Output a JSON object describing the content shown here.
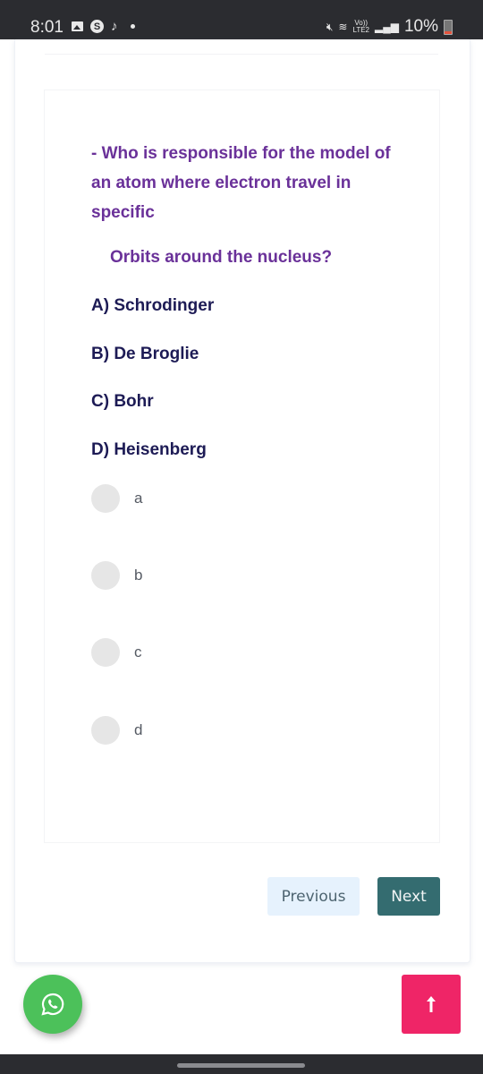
{
  "status_bar": {
    "time": "8:01",
    "left_icons": [
      "gallery-icon",
      "s-app-icon",
      "music-note-icon",
      "dot-icon"
    ],
    "right_icons": [
      "mute-icon",
      "wifi-icon",
      "volte-icon",
      "signal-icon"
    ],
    "volte_label_top": "Vo))",
    "volte_label_bottom": "LTE2",
    "battery": "10%"
  },
  "question": {
    "text": "- Who is responsible for the model of an atom where electron travel in specific",
    "continuation": "Orbits around the nucleus?",
    "options": [
      {
        "label": "A) Schrodinger"
      },
      {
        "label": "B) De Broglie"
      },
      {
        "label": "C) Bohr"
      },
      {
        "label": "D) Heisenberg"
      }
    ]
  },
  "answers": [
    {
      "label": "a",
      "selected": false
    },
    {
      "label": "b",
      "selected": false
    },
    {
      "label": "c",
      "selected": false
    },
    {
      "label": "d",
      "selected": false
    }
  ],
  "navigation": {
    "previous_label": "Previous",
    "next_label": "Next"
  },
  "floating": {
    "whatsapp_icon": "whatsapp-icon",
    "scroll_top_icon": "arrow-up-icon"
  },
  "colors": {
    "question": "#6a3199",
    "option": "#1d1b55",
    "next_button": "#346c70",
    "previous_button": "#e6f2fd",
    "whatsapp": "#4cc15a",
    "scroll_top": "#ef2567"
  }
}
